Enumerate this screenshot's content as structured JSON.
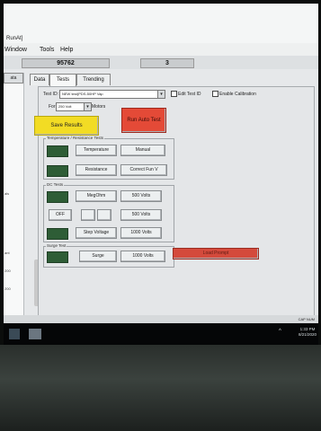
{
  "window": {
    "title": "RunAt]"
  },
  "menu": [
    "Window",
    "Tools",
    "Help"
  ],
  "header_fields": {
    "serial": "95762",
    "count": "3"
  },
  "left_panel": {
    "tab_label": "ata",
    "labels": [
      "als",
      "ant",
      "200",
      "200"
    ]
  },
  "tabs": [
    {
      "label": "Data",
      "active": false
    },
    {
      "label": "Tests",
      "active": true
    },
    {
      "label": "Trending",
      "active": false
    }
  ],
  "test_id": {
    "label": "Test ID:",
    "value": "NEW test(PDS-50HP Vap"
  },
  "checkboxes": {
    "edit_test_id": "Edit Test ID",
    "enable_calibration": "Enable Calibration"
  },
  "for_row": {
    "label": "For",
    "value": "250 Volt",
    "suffix": "Motors"
  },
  "buttons": {
    "save_results": "Save Results",
    "run_auto_test": "Run Auto Test",
    "temperature": "Temperature",
    "manual": "Manual",
    "resistance": "Resistance",
    "compensate": "Correct Fun V",
    "meg_ohm": "MegOhm",
    "v500_1": "500 Volts",
    "off": "OFF",
    "v500_2": "500 Volts",
    "step_voltage": "Step Voltage",
    "v1000_1": "1000 Volts",
    "surge": "Surge",
    "v1000_2": "1000 Volts",
    "upper_right": "Load Prompt"
  },
  "groups": {
    "temp_resistance": "Temperature / Resistance Tests",
    "dc_tests": "DC Tests",
    "surge_test": "Surge Test"
  },
  "status": {
    "right": "CAP  NUM"
  },
  "taskbar": {
    "time": "1:33 PM",
    "date": "8/21/2020"
  },
  "colors": {
    "save_button": "#f2dc24",
    "run_button": "#e44a37",
    "indicator": "#2e5d36",
    "alert_bar": "#d44a3c"
  }
}
